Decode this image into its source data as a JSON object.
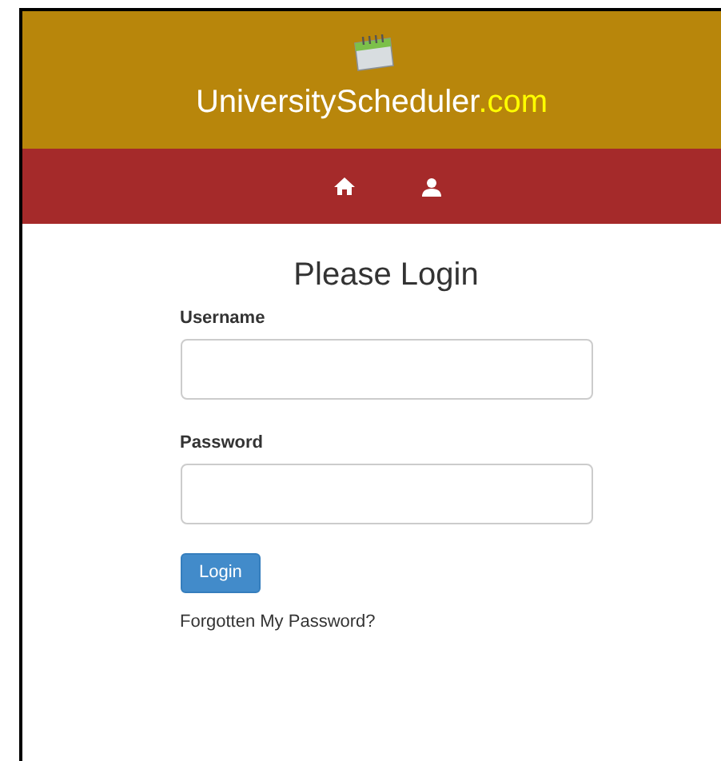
{
  "header": {
    "brand": "UniversityScheduler",
    "brand_suffix": ".com"
  },
  "nav": {
    "items": [
      {
        "kind": "home"
      },
      {
        "kind": "user"
      }
    ]
  },
  "login": {
    "title": "Please Login",
    "fields": [
      {
        "label": "Username"
      },
      {
        "label": "Password"
      }
    ],
    "submit": "Login",
    "forgot_link": "Forgotten My Password?"
  }
}
